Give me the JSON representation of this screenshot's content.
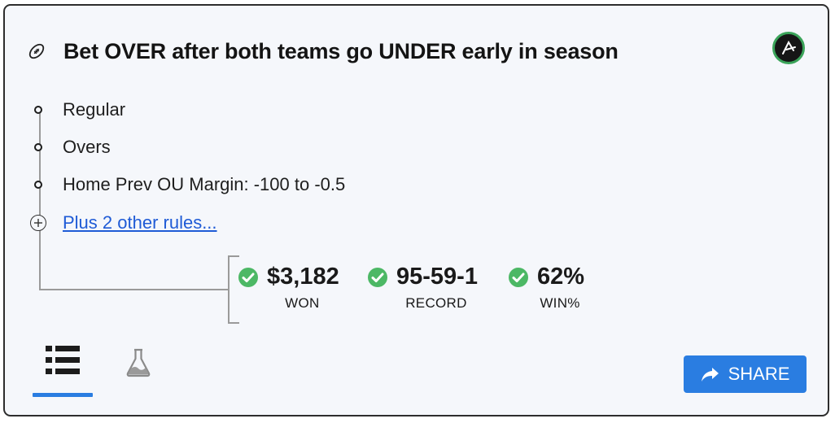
{
  "system": {
    "title": "Bet OVER after both teams go UNDER early in season",
    "rules": [
      "Regular",
      "Overs",
      "Home Prev OU Margin: -100 to -0.5"
    ],
    "more_rules_link": "Plus 2 other rules..."
  },
  "stats": [
    {
      "value": "$3,182",
      "label": "WON"
    },
    {
      "value": "95-59-1",
      "label": "RECORD"
    },
    {
      "value": "62%",
      "label": "WIN%"
    }
  ],
  "tabs": {
    "active": "list-view"
  },
  "actions": {
    "share_label": "SHARE"
  },
  "colors": {
    "accent": "#2a7de1",
    "success": "#4cb865",
    "link": "#1f5bd6"
  },
  "icons": [
    "football-icon",
    "action-logo-icon",
    "check-icon",
    "list-icon",
    "flask-icon",
    "share-arrow-icon"
  ]
}
